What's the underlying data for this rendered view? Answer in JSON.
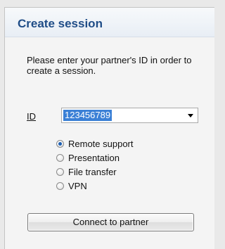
{
  "panel": {
    "title": "Create session",
    "description": "Please enter your partner's ID in order to create a session."
  },
  "id_field": {
    "label": "ID",
    "value": "123456789",
    "arrow_icon": "chevron-down-icon"
  },
  "connection_types": [
    {
      "label": "Remote support",
      "checked": true
    },
    {
      "label": "Presentation",
      "checked": false
    },
    {
      "label": "File transfer",
      "checked": false
    },
    {
      "label": "VPN",
      "checked": false
    }
  ],
  "actions": {
    "connect_label": "Connect to partner"
  },
  "colors": {
    "title": "#1f4d87",
    "selection": "#3b80d6",
    "radio_dot": "#1d5fb3"
  }
}
